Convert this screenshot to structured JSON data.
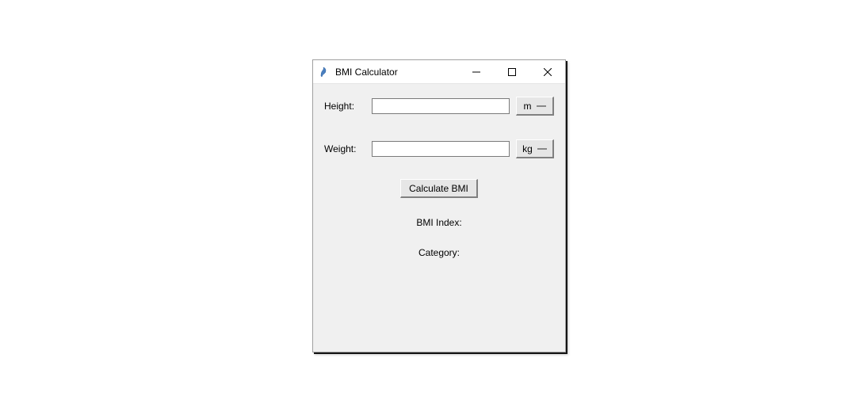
{
  "window": {
    "title": "BMI Calculator"
  },
  "form": {
    "height_label": "Height:",
    "height_value": "",
    "height_unit": "m",
    "weight_label": "Weight:",
    "weight_value": "",
    "weight_unit": "kg",
    "calculate_label": "Calculate BMI",
    "bmi_index_label": "BMI Index:",
    "category_label": "Category:"
  }
}
